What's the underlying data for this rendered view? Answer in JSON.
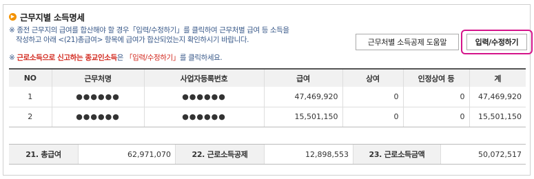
{
  "section": {
    "title": "근무지별 소득명세",
    "notice_line1": "※ 종전 근무지의 급여를 합산해야 할 경우「입력/수정하기」를 클릭하여 근무처별 급여 등 소득을",
    "notice_line2": "작성하고 아래 <(21)총급여> 항목에 급여가 합산되었는지 확인하시기 바랍니다.",
    "notice2_mark": "※ ",
    "notice2_red": "근로소득으로 신고하는 종교인소득",
    "notice2_mid": "은 ",
    "notice2_link": "「입력/수정하기」",
    "notice2_tail": "를 클릭하세요."
  },
  "buttons": {
    "help": "근무처별 소득공제 도움말",
    "edit": "입력/수정하기"
  },
  "table": {
    "headers": [
      "NO",
      "근무처명",
      "사업자등록번호",
      "급여",
      "상여",
      "인정상여 등",
      "계"
    ],
    "rows": [
      [
        "1",
        "●●●●●●",
        "●●●●●●",
        "47,469,920",
        "0",
        "0",
        "47,469,920"
      ],
      [
        "2",
        "●●●●●●",
        "●●●●●●",
        "15,501,150",
        "0",
        "0",
        "15,501,150"
      ]
    ]
  },
  "summary": {
    "total_pay_label": "21. 총급여",
    "total_pay_value": "62,971,070",
    "deduction_label": "22. 근로소득공제",
    "deduction_value": "12,898,553",
    "income_label": "23. 근로소득금액",
    "income_value": "50,072,517"
  },
  "colors": {
    "accent_icon": "#f39200",
    "highlight_border": "#d4148a",
    "warning_red": "#d2281e",
    "notice_blue": "#3a5a8a"
  }
}
